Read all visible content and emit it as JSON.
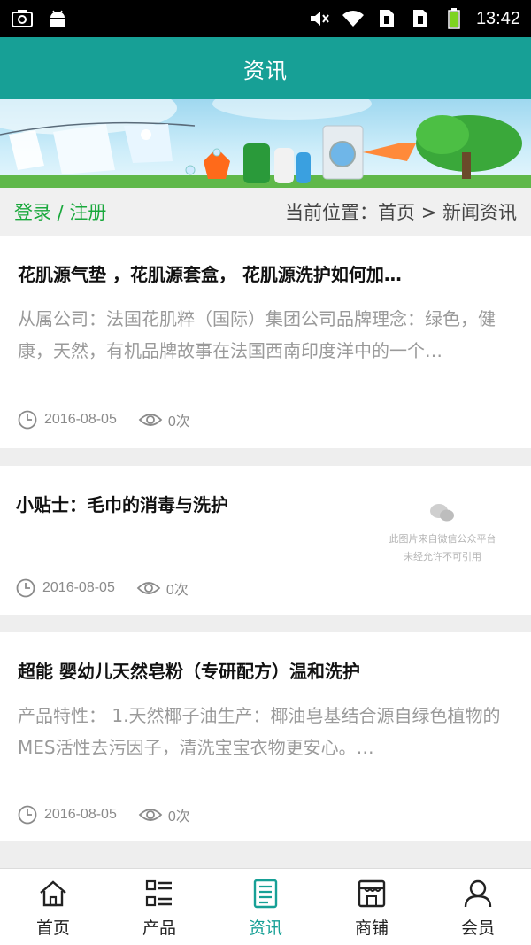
{
  "status_bar": {
    "time": "13:42"
  },
  "header": {
    "title": "资讯"
  },
  "breadcrumb_bar": {
    "login": "登录 / 注册",
    "location": "当前位置：首页 > 新闻资讯"
  },
  "articles": [
    {
      "title": "花肌源气垫 ，花肌源套盒， 花肌源洗护如何加…",
      "summary": "从属公司：法国花肌粹（国际）集团公司品牌理念：绿色，健康，天然，有机品牌故事在法国西南印度洋中的一个…",
      "date": "2016-08-05",
      "views": "0次"
    },
    {
      "title": "小贴士：毛巾的消毒与洗护",
      "summary": "",
      "watermark": [
        "此图片来自微信公众平台",
        "未经允许不可引用"
      ],
      "date": "2016-08-05",
      "views": "0次"
    },
    {
      "title": "超能 婴幼儿天然皂粉（专研配方）温和洗护",
      "summary": "产品特性： 1.天然椰子油生产：椰油皂基结合源自绿色植物的MES活性去污因子，清洗宝宝衣物更安心。…",
      "date": "2016-08-05",
      "views": "0次"
    }
  ],
  "bottom_nav": [
    {
      "label": "首页",
      "icon": "home-icon",
      "active": false
    },
    {
      "label": "产品",
      "icon": "grid-list-icon",
      "active": false
    },
    {
      "label": "资讯",
      "icon": "document-icon",
      "active": true
    },
    {
      "label": "商铺",
      "icon": "shop-icon",
      "active": false
    },
    {
      "label": "会员",
      "icon": "user-icon",
      "active": false
    }
  ],
  "colors": {
    "primary": "#17a096",
    "login_green": "#19a83c",
    "active_nav": "#17a096"
  }
}
